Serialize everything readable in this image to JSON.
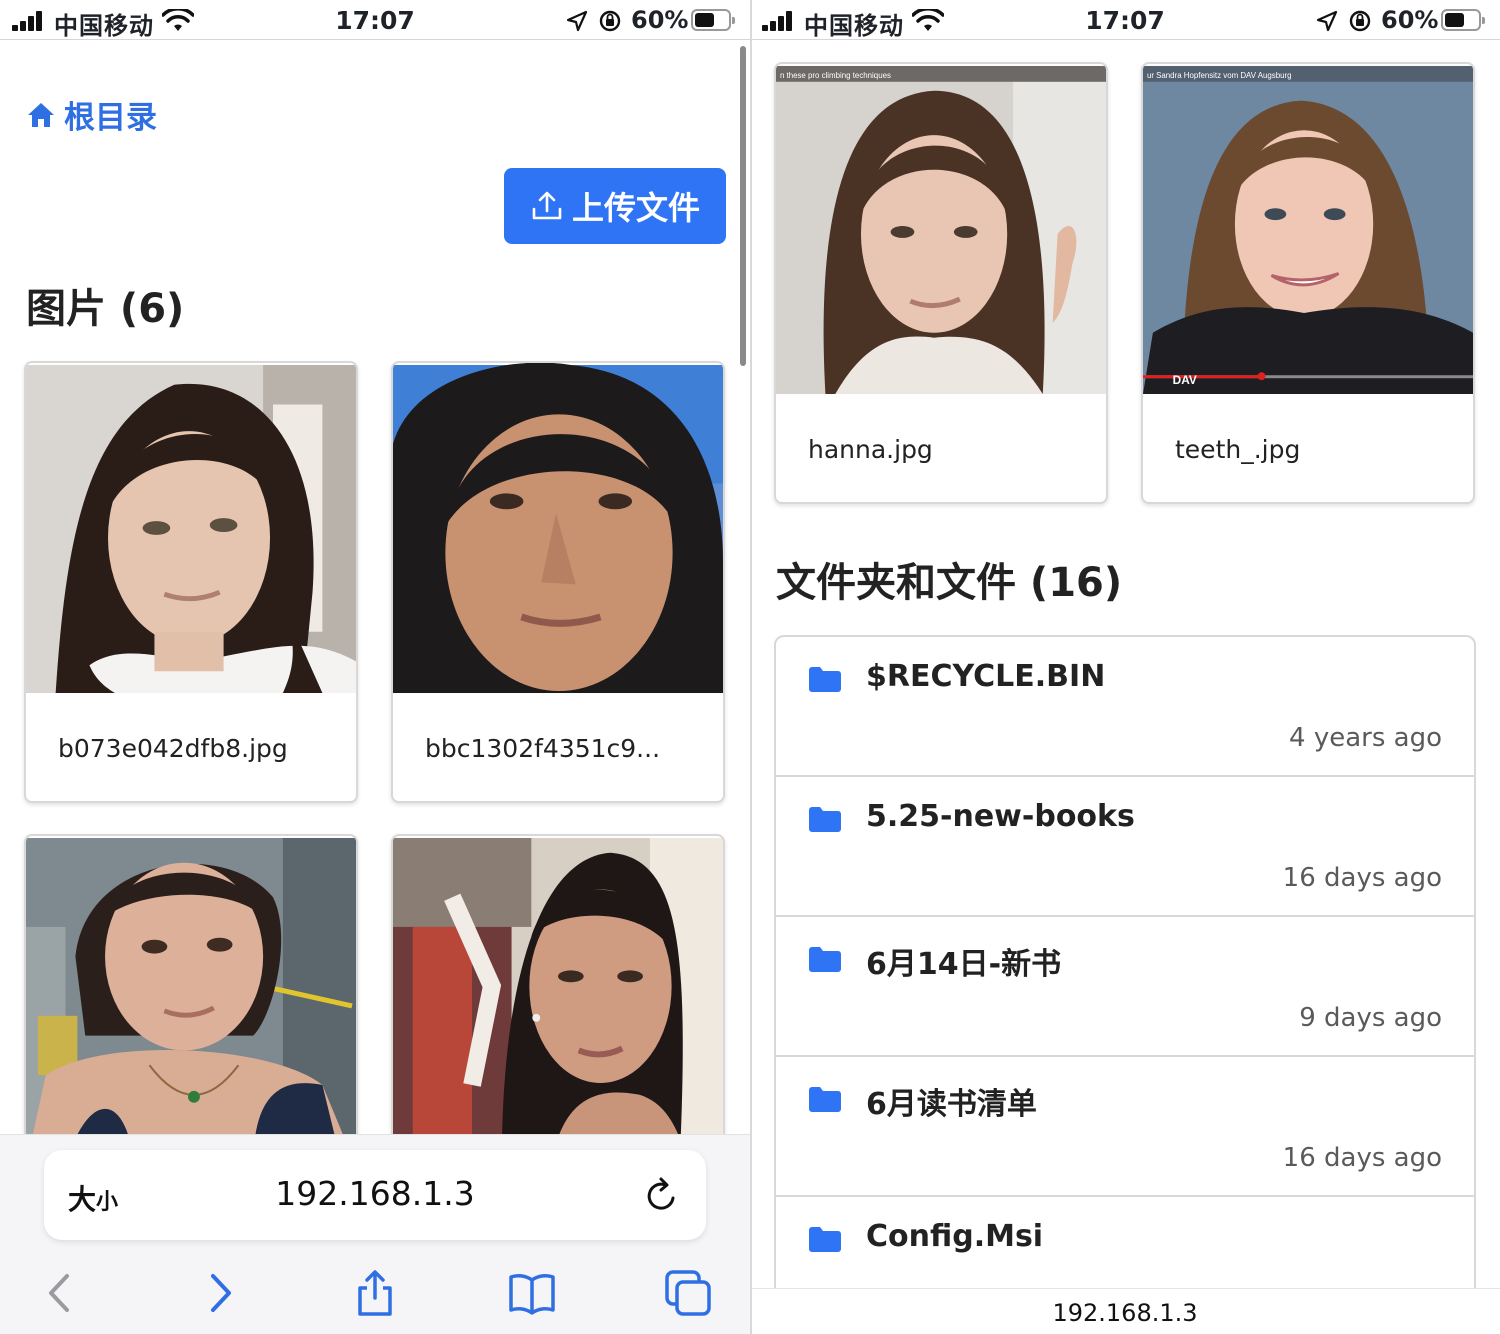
{
  "status": {
    "carrier": "中国移动",
    "time": "17:07",
    "battery": "60%",
    "battery_level": 0.6
  },
  "breadcrumb": {
    "label": "根目录"
  },
  "upload": {
    "label": "上传文件"
  },
  "images_section": {
    "title": "图片 (6)"
  },
  "image_cards": [
    {
      "name": "b073e042dfb8.jpg"
    },
    {
      "name": "bbc1302f4351c9..."
    },
    {
      "name": ""
    },
    {
      "name": ""
    },
    {
      "name": "hanna.jpg",
      "caption": "n these pro climbing techniques"
    },
    {
      "name": "teeth_.jpg",
      "caption": "ur Sandra Hopfensitz vom DAV Augsburg",
      "logo": "DAV"
    }
  ],
  "safari": {
    "size_label_big": "大",
    "size_label_small": "小",
    "url": "192.168.1.3"
  },
  "folders_section": {
    "title": "文件夹和文件 (16)"
  },
  "folders": [
    {
      "name": "$RECYCLE.BIN",
      "date": "4 years ago"
    },
    {
      "name": "5.25-new-books",
      "date": "16 days ago"
    },
    {
      "name": "6月14日-新书",
      "date": "9 days ago"
    },
    {
      "name": "6月读书清单",
      "date": "16 days ago"
    },
    {
      "name": "Config.Msi",
      "date": ""
    }
  ],
  "bottom_url": "192.168.1.3",
  "colors": {
    "accent": "#2f74f4",
    "link": "#2f6fe4",
    "folder": "#2f74f4"
  }
}
